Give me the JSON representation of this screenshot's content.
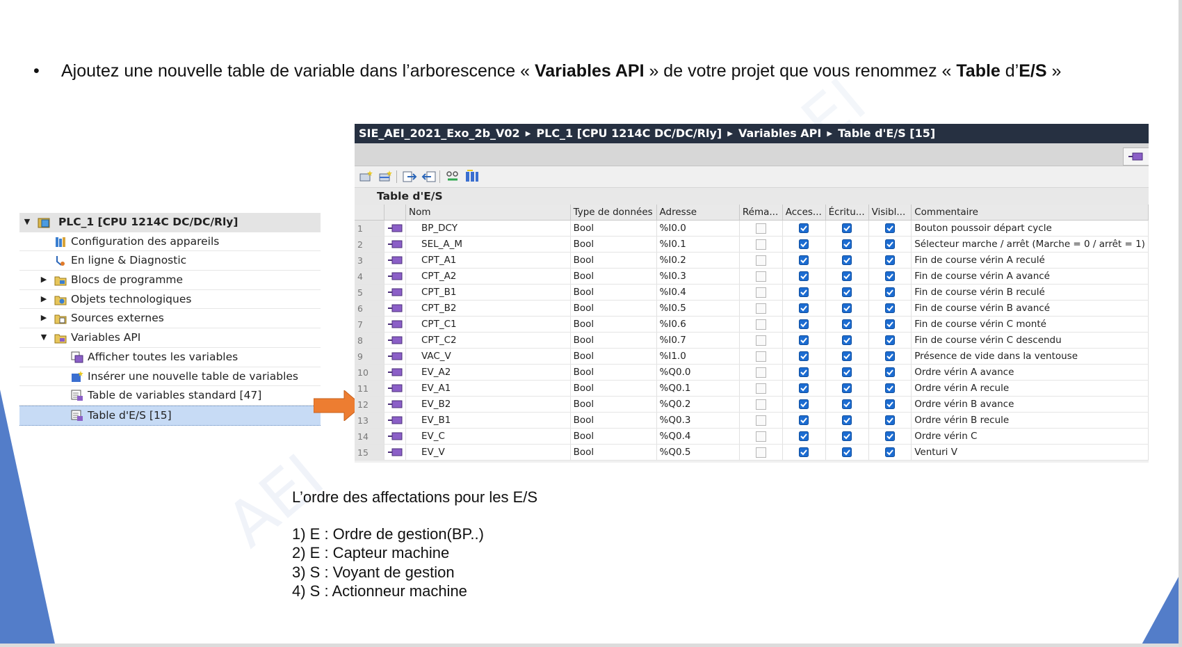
{
  "instruction": {
    "bullet": "•",
    "parts": [
      "Ajoutez une nouvelle table de variable dans l’arborescence « ",
      "Variables API",
      " » de votre projet que vous renommez « ",
      "Table",
      " d’",
      "E/S",
      " »"
    ]
  },
  "tree": {
    "items": [
      {
        "label": "PLC_1 [CPU 1214C DC/DC/Rly]",
        "icon": "plc-folder-icon",
        "expander": "▼"
      },
      {
        "label": "Configuration des appareils",
        "icon": "device-config-icon",
        "expander": ""
      },
      {
        "label": "En ligne & Diagnostic",
        "icon": "online-diagnostic-icon",
        "expander": ""
      },
      {
        "label": "Blocs de programme",
        "icon": "folder-icon",
        "expander": "▶"
      },
      {
        "label": "Objets technologiques",
        "icon": "folder-gear-icon",
        "expander": "▶"
      },
      {
        "label": "Sources externes",
        "icon": "folder-source-icon",
        "expander": "▶"
      },
      {
        "label": "Variables API",
        "icon": "folder-tag-icon",
        "expander": "▼"
      },
      {
        "label": "Afficher toutes les variables",
        "icon": "show-tags-icon",
        "expander": ""
      },
      {
        "label": "Insérer une nouvelle table de variables",
        "icon": "add-table-icon",
        "expander": ""
      },
      {
        "label": "Table de variables standard [47]",
        "icon": "tag-table-icon",
        "expander": ""
      },
      {
        "label": "Table d'E/S [15]",
        "icon": "tag-table-icon",
        "expander": ""
      }
    ]
  },
  "window": {
    "breadcrumb": [
      "SIE_AEI_2021_Exo_2b_V02",
      "PLC_1 [CPU 1214C DC/DC/Rly]",
      "Variables API",
      "Table d'E/S [15]"
    ],
    "breadcrumb_sep": "▶",
    "table_title": "Table d'E/S",
    "toolbar_icons": [
      "add-row-icon",
      "insert-row-icon",
      "export-icon",
      "import-icon",
      "monitor-icon",
      "settings-columns-icon"
    ]
  },
  "table": {
    "columns": [
      "",
      "",
      "Nom",
      "Type de données",
      "Adresse",
      "Réma...",
      "Acces...",
      "Écritu...",
      "Visibl...",
      "Commentaire"
    ],
    "rows": [
      {
        "n": "1",
        "name": "BP_DCY",
        "type": "Bool",
        "addr": "%I0.0",
        "comment": "Bouton poussoir départ cycle"
      },
      {
        "n": "2",
        "name": "SEL_A_M",
        "type": "Bool",
        "addr": "%I0.1",
        "comment": "Sélecteur marche / arrêt (Marche = 0 / arrêt = 1)"
      },
      {
        "n": "3",
        "name": "CPT_A1",
        "type": "Bool",
        "addr": "%I0.2",
        "comment": "Fin de course vérin A reculé"
      },
      {
        "n": "4",
        "name": "CPT_A2",
        "type": "Bool",
        "addr": "%I0.3",
        "comment": "Fin de course vérin A avancé"
      },
      {
        "n": "5",
        "name": "CPT_B1",
        "type": "Bool",
        "addr": "%I0.4",
        "comment": "Fin de course vérin B reculé"
      },
      {
        "n": "6",
        "name": "CPT_B2",
        "type": "Bool",
        "addr": "%I0.5",
        "comment": "Fin de course vérin B avancé"
      },
      {
        "n": "7",
        "name": "CPT_C1",
        "type": "Bool",
        "addr": "%I0.6",
        "comment": "Fin de course vérin C monté"
      },
      {
        "n": "8",
        "name": "CPT_C2",
        "type": "Bool",
        "addr": "%I0.7",
        "comment": "Fin de course vérin C descendu"
      },
      {
        "n": "9",
        "name": "VAC_V",
        "type": "Bool",
        "addr": "%I1.0",
        "comment": "Présence de vide dans la ventouse"
      },
      {
        "n": "10",
        "name": "EV_A2",
        "type": "Bool",
        "addr": "%Q0.0",
        "comment": "Ordre vérin A avance"
      },
      {
        "n": "11",
        "name": "EV_A1",
        "type": "Bool",
        "addr": "%Q0.1",
        "comment": "Ordre vérin A recule"
      },
      {
        "n": "12",
        "name": "EV_B2",
        "type": "Bool",
        "addr": "%Q0.2",
        "comment": "Ordre vérin B avance"
      },
      {
        "n": "13",
        "name": "EV_B1",
        "type": "Bool",
        "addr": "%Q0.3",
        "comment": "Ordre vérin B recule"
      },
      {
        "n": "14",
        "name": "EV_C",
        "type": "Bool",
        "addr": "%Q0.4",
        "comment": "Ordre vérin C"
      },
      {
        "n": "15",
        "name": "EV_V",
        "type": "Bool",
        "addr": "%Q0.5",
        "comment": "Venturi V"
      }
    ],
    "flags": {
      "retain": false,
      "accessible": true,
      "writable": true,
      "visible": true
    }
  },
  "notes": {
    "title": "L’ordre des affectations pour les E/S",
    "items": [
      "1) E : Ordre de gestion(BP..)",
      "2) E : Capteur machine",
      "3) S : Voyant  de gestion",
      "4) S : Actionneur machine"
    ]
  },
  "colors": {
    "accent_blue": "#4472c4",
    "arrow_orange": "#ed7d31",
    "breadcrumb_bg": "#263041",
    "check_blue": "#1c6cd1",
    "selection": "#c7dbf5"
  }
}
